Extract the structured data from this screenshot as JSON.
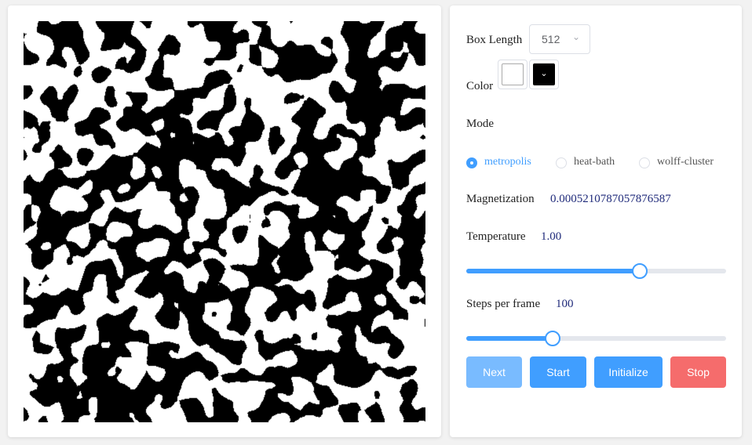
{
  "settings": {
    "box_length_label": "Box Length",
    "box_length_value": "512",
    "color_label": "Color",
    "colors": {
      "spin_up": "#ffffff",
      "spin_down": "#000000"
    },
    "mode_label": "Mode",
    "modes": [
      {
        "label": "metropolis",
        "checked": true
      },
      {
        "label": "heat-bath",
        "checked": false
      },
      {
        "label": "wolff-cluster",
        "checked": false
      }
    ]
  },
  "stats": {
    "magnetization_label": "Magnetization",
    "magnetization_value": "0.0005210787057876587"
  },
  "temperature": {
    "label": "Temperature",
    "value": "1.00",
    "slider_fraction": 0.667
  },
  "steps": {
    "label": "Steps per frame",
    "value": "100",
    "slider_fraction": 0.333
  },
  "buttons": {
    "next": "Next",
    "start": "Start",
    "initialize": "Initialize",
    "stop": "Stop"
  }
}
